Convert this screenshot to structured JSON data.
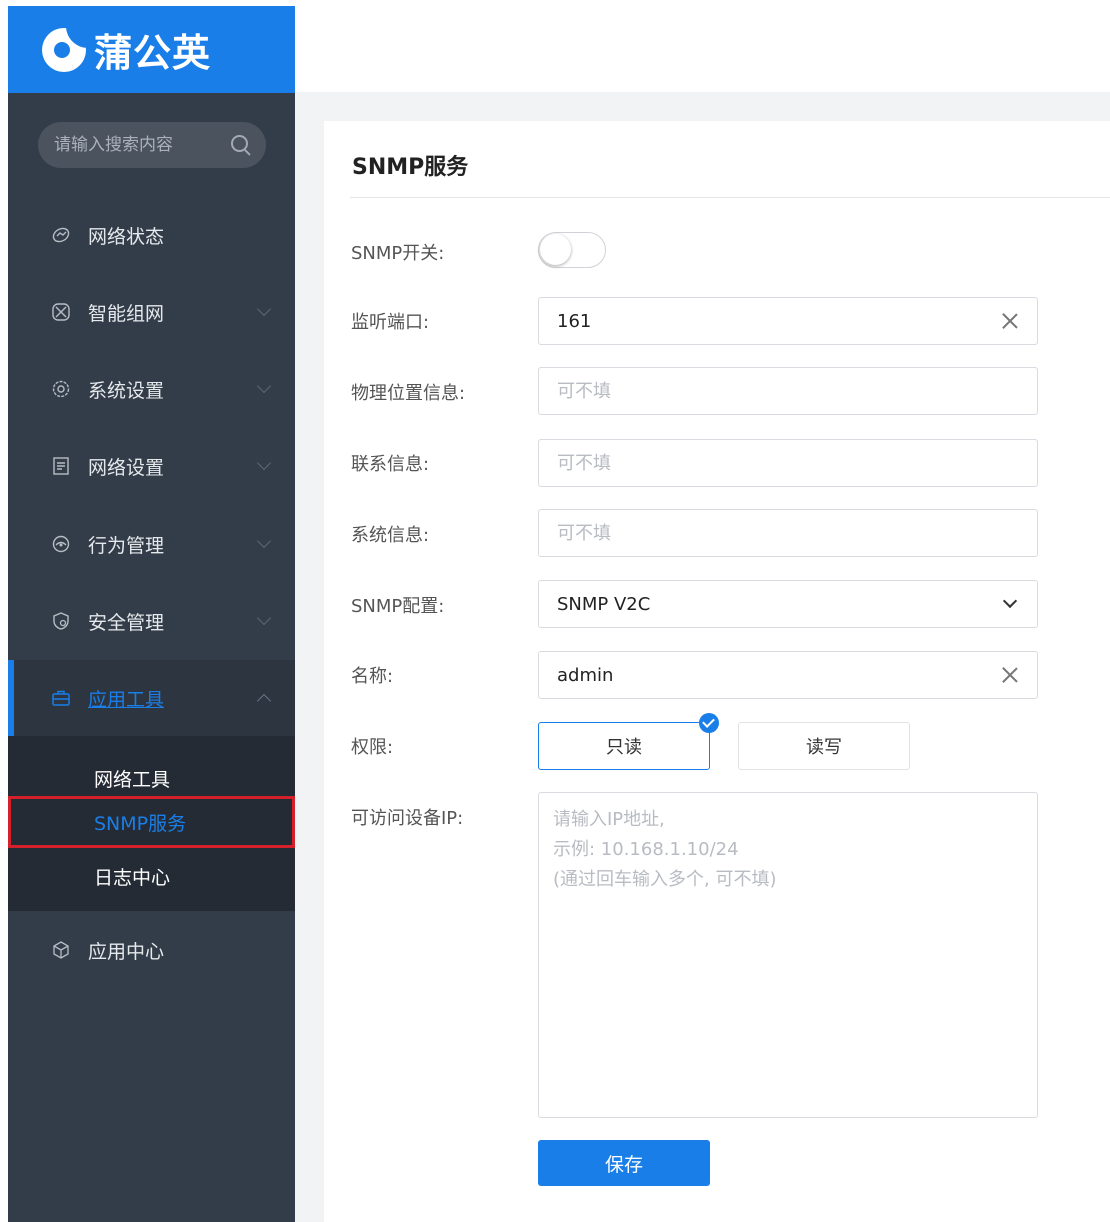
{
  "brand": {
    "name": "蒲公英"
  },
  "search": {
    "placeholder": "请输入搜索内容"
  },
  "sidebar": {
    "items": [
      {
        "label": "网络状态",
        "icon": "network-status-icon",
        "expandable": false
      },
      {
        "label": "智能组网",
        "icon": "smart-networking-icon",
        "expandable": true
      },
      {
        "label": "系统设置",
        "icon": "settings-icon",
        "expandable": true
      },
      {
        "label": "网络设置",
        "icon": "network-settings-icon",
        "expandable": true
      },
      {
        "label": "行为管理",
        "icon": "behavior-icon",
        "expandable": true
      },
      {
        "label": "安全管理",
        "icon": "security-icon",
        "expandable": true
      },
      {
        "label": "应用工具",
        "icon": "toolbox-icon",
        "expandable": true,
        "expanded": true,
        "active": true
      },
      {
        "label": "应用中心",
        "icon": "cube-icon",
        "expandable": false
      }
    ],
    "submenu": [
      {
        "label": "网络工具"
      },
      {
        "label": "SNMP服务",
        "selected": true
      },
      {
        "label": "日志中心"
      }
    ]
  },
  "panel": {
    "title": "SNMP服务",
    "form": {
      "snmp_switch_label": "SNMP开关:",
      "snmp_switch_on": false,
      "port_label": "监听端口:",
      "port_value": "161",
      "location_label": "物理位置信息:",
      "location_placeholder": "可不填",
      "contact_label": "联系信息:",
      "contact_placeholder": "可不填",
      "sysinfo_label": "系统信息:",
      "sysinfo_placeholder": "可不填",
      "config_label": "SNMP配置:",
      "config_value": "SNMP V2C",
      "name_label": "名称:",
      "name_value": "admin",
      "permission_label": "权限:",
      "permission_options": [
        "只读",
        "读写"
      ],
      "permission_selected": "只读",
      "ip_label": "可访问设备IP:",
      "ip_placeholder_lines": [
        "请输入IP地址,",
        "示例: 10.168.1.10/24",
        "(通过回车输入多个, 可不填)"
      ],
      "save_label": "保存"
    }
  },
  "colors": {
    "accent": "#1a7ee8",
    "sidebar_bg": "#333d49",
    "submenu_bg": "#242b34",
    "highlight_box": "#d3202a"
  }
}
